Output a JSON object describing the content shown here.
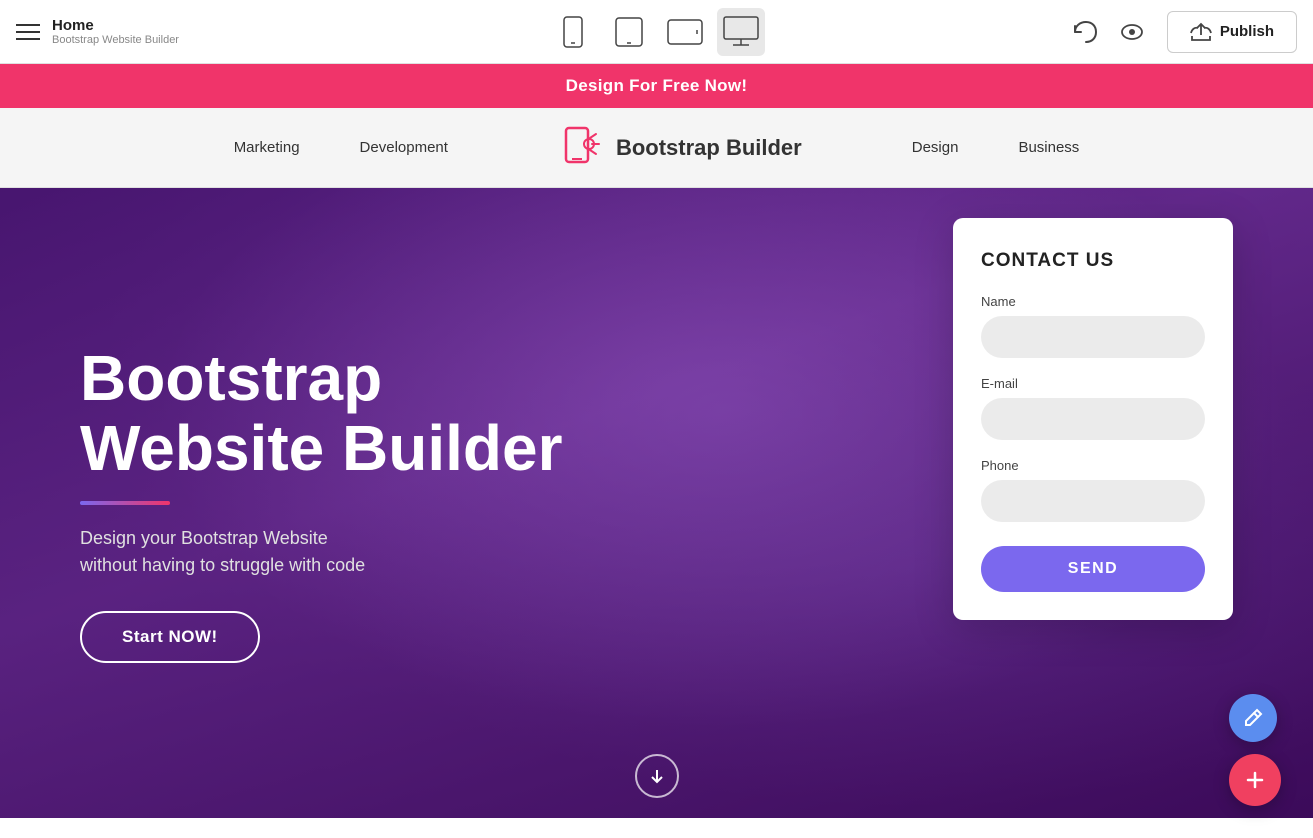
{
  "toolbar": {
    "home_label": "Home",
    "subtitle": "Bootstrap Website Builder",
    "hamburger_label": "Menu",
    "undo_label": "Undo",
    "preview_label": "Preview",
    "publish_label": "Publish",
    "devices": [
      {
        "id": "mobile",
        "label": "Mobile"
      },
      {
        "id": "tablet",
        "label": "Tablet"
      },
      {
        "id": "tablet-landscape",
        "label": "Tablet Landscape"
      },
      {
        "id": "desktop",
        "label": "Desktop"
      }
    ]
  },
  "promo": {
    "text": "Design For Free Now!"
  },
  "site_nav": {
    "brand_name": "Bootstrap Builder",
    "links": [
      {
        "label": "Marketing"
      },
      {
        "label": "Development"
      },
      {
        "label": "Design"
      },
      {
        "label": "Business"
      }
    ]
  },
  "hero": {
    "title_line1": "Bootstrap",
    "title_line2": "Website Builder",
    "subtitle": "Design your Bootstrap Website\nwithout having to struggle with code",
    "cta_label": "Start NOW!"
  },
  "contact_form": {
    "title": "CONTACT US",
    "name_label": "Name",
    "name_placeholder": "",
    "email_label": "E-mail",
    "email_placeholder": "",
    "phone_label": "Phone",
    "phone_placeholder": "",
    "send_label": "SEND"
  },
  "fab": {
    "pencil_label": "Edit",
    "plus_label": "Add"
  }
}
